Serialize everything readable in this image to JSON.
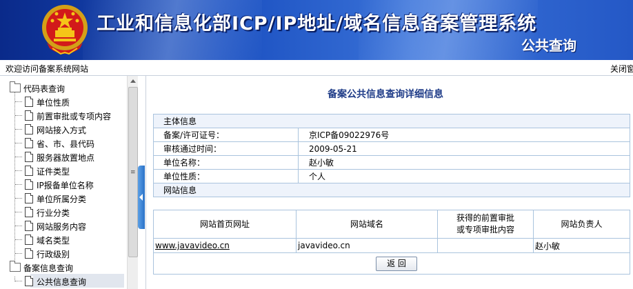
{
  "banner": {
    "title": "工业和信息化部ICP/IP地址/域名信息备案管理系统",
    "subtitle": "公共查询"
  },
  "topbar": {
    "welcome": "欢迎访问备案系统网站",
    "close": "关闭窗"
  },
  "sidebar": {
    "groups": [
      {
        "label": "代码表查询",
        "items": [
          "单位性质",
          "前置审批或专项内容",
          "网站接入方式",
          "省、市、县代码",
          "服务器放置地点",
          "证件类型",
          "IP报备单位名称",
          "单位所属分类",
          "行业分类",
          "网站服务内容",
          "域名类型",
          "行政级别"
        ]
      },
      {
        "label": "备案信息查询",
        "items": [
          "公共信息查询"
        ]
      }
    ],
    "selected": "公共信息查询"
  },
  "main": {
    "title": "备案公共信息查询详细信息",
    "subject_section": "主体信息",
    "fields": [
      {
        "label": "备案/许可证号：",
        "value": "京ICP备09022976号"
      },
      {
        "label": "审核通过时间：",
        "value": "2009-05-21"
      },
      {
        "label": "单位名称：",
        "value": "赵小敏"
      },
      {
        "label": "单位性质：",
        "value": "个人"
      }
    ],
    "website_section": "网站信息",
    "site_columns": [
      "网站首页网址",
      "网站域名",
      "获得的前置审批\n或专项审批内容",
      "网站负责人"
    ],
    "site_rows": [
      {
        "url": "www.javavideo.cn",
        "domain": "javavideo.cn",
        "approval": "",
        "owner": "赵小敏"
      }
    ],
    "back_button": "返 回"
  },
  "colors": {
    "banner_dark": "#0a2a8a",
    "banner_light": "#3a72d8",
    "title_text": "#1f3c88",
    "table_border": "#a9c3dd"
  }
}
